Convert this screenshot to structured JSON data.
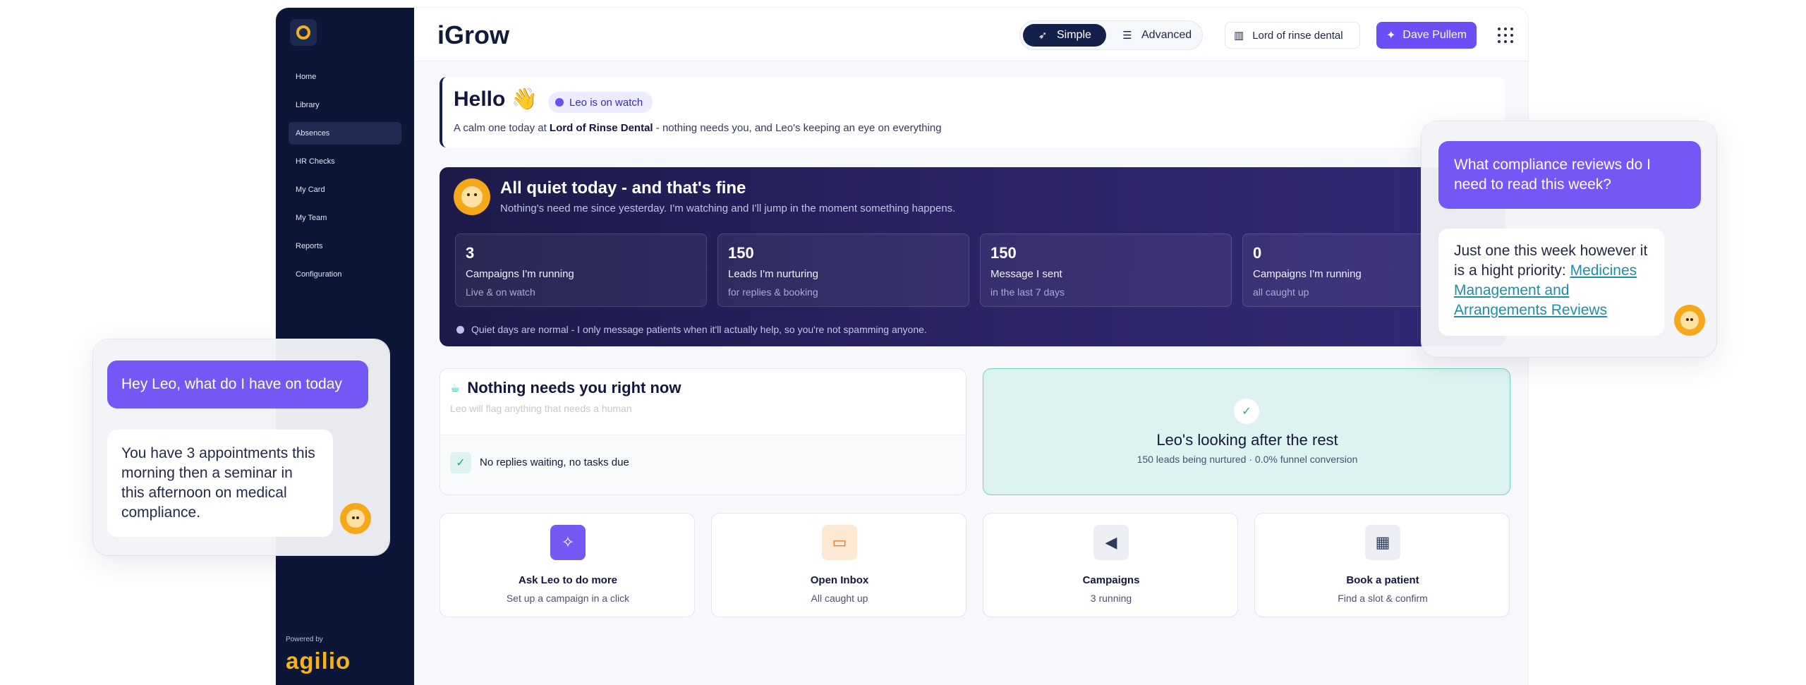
{
  "app": {
    "title": "iGrow"
  },
  "sidebar": {
    "items": [
      {
        "label": "Home"
      },
      {
        "label": "Library"
      },
      {
        "label": "Absences"
      },
      {
        "label": "HR Checks"
      },
      {
        "label": "My Card"
      },
      {
        "label": "My Team"
      },
      {
        "label": "Reports"
      },
      {
        "label": "Configuration"
      }
    ],
    "active": "Absences",
    "powered_by": "Powered by",
    "brand": "agilio"
  },
  "header": {
    "mode_simple": "Simple",
    "mode_advanced": "Advanced",
    "practice": "Lord of rinse dental",
    "user": "Dave Pullem"
  },
  "hello": {
    "title": "Hello",
    "emoji": "👋",
    "badge": "Leo is on watch",
    "sub_prefix": "A calm one today at ",
    "sub_practice": "Lord of Rinse Dental",
    "sub_suffix": " - nothing needs you, and Leo's keeping an eye on everything"
  },
  "quiet": {
    "title": "All quiet today - and that's fine",
    "subtitle": "Nothing's need me since yesterday. I'm watching and I'll jump in the moment something happens.",
    "stats": [
      {
        "value": "3",
        "label": "Campaigns I'm running",
        "sub": "Live & on watch"
      },
      {
        "value": "150",
        "label": "Leads I'm nurturing",
        "sub": "for replies & booking"
      },
      {
        "value": "150",
        "label": "Message I sent",
        "sub": "in the last 7 days"
      },
      {
        "value": "0",
        "label": "Campaigns I'm running",
        "sub": "all caught up"
      }
    ],
    "note": "Quiet days are normal - I only message patients when it'll actually help, so you're not spamming anyone."
  },
  "nothing": {
    "title": "Nothing needs you right now",
    "sub": "Leo will flag anything that needs a human",
    "item": "No replies waiting, no tasks due"
  },
  "after": {
    "title": "Leo's looking after the rest",
    "sub": "150 leads being nurtured · 0.0% funnel conversion"
  },
  "actions": [
    {
      "title": "Ask Leo to do more",
      "sub": "Set up a campaign in a click",
      "icon": "magic-wand-icon"
    },
    {
      "title": "Open Inbox",
      "sub": "All caught up",
      "icon": "inbox-icon"
    },
    {
      "title": "Campaigns",
      "sub": "3 running",
      "icon": "megaphone-icon"
    },
    {
      "title": "Book a patient",
      "sub": "Find a slot & confirm",
      "icon": "calendar-plus-icon"
    }
  ],
  "chat_left": {
    "user": "Hey Leo, what do I have on today",
    "bot": "You have 3 appointments this morning then a seminar in this afternoon on medical compliance."
  },
  "chat_right": {
    "user": "What compliance reviews do I need to read this week?",
    "bot": "Just one this week however it is a hight priority:",
    "link": "Medicines Management and Arrangements Reviews"
  },
  "colors": {
    "sidebar": "#0c1738",
    "accent": "#6c4ef5",
    "brand": "#f6b21a",
    "teal": "#1fb7a3"
  }
}
